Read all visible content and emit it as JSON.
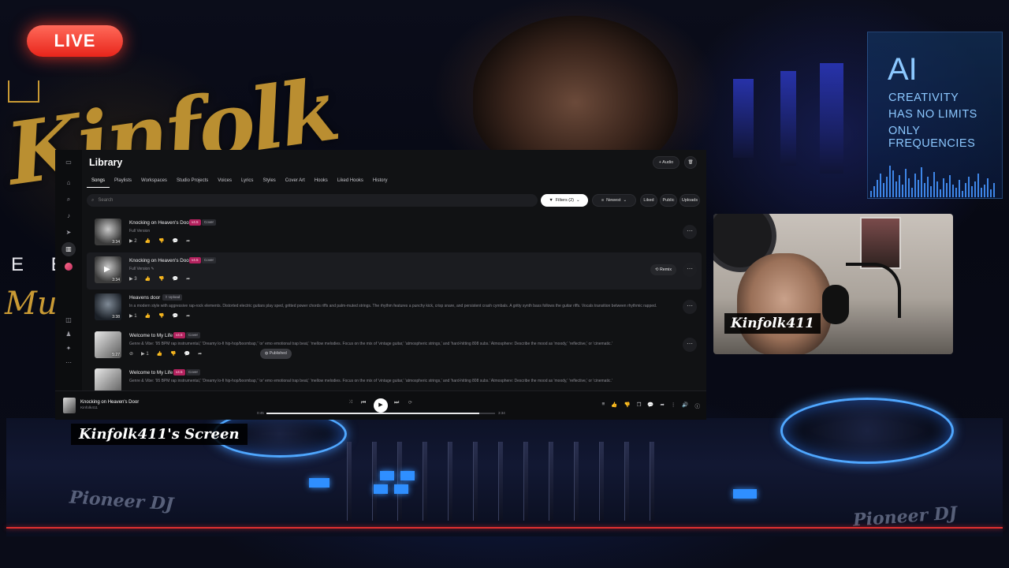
{
  "overlay": {
    "live_label": "LIVE",
    "brand_text": "Kinfolk",
    "brand_sub": "E E",
    "brand_much": "Much",
    "ai_panel": {
      "title": "AI",
      "lines": [
        "CREATIVITY",
        "HAS NO LIMITS",
        "ONLY FREQUENCIES"
      ]
    },
    "deck_brand_left": "Pioneer DJ",
    "deck_brand_right": "Pioneer DJ",
    "screen_caption": "Kinfolk411's Screen",
    "cam_caption": "Kinfolk411",
    "accent_live": "#e8251b",
    "accent_gold": "#c99a34",
    "accent_blue": "#4fa7ff"
  },
  "app": {
    "title": "Library",
    "header_buttons": {
      "audio": "+ Audio",
      "trash_icon": "trash-icon"
    },
    "rail_icons": [
      "window-icon",
      "home-icon",
      "search-icon",
      "create-icon",
      "explore-icon",
      "library-icon",
      "profile-icon",
      "notifications-icon",
      "invite-icon",
      "gift-icon",
      "more-icon"
    ],
    "tabs": [
      "Songs",
      "Playlists",
      "Workspaces",
      "Studio Projects",
      "Voices",
      "Lyrics",
      "Styles",
      "Cover Art",
      "Hooks",
      "Liked Hooks",
      "History"
    ],
    "active_tab": "Songs",
    "search_placeholder": "Search",
    "filters": {
      "filters_label": "Filters (2)",
      "sort_label": "Newest",
      "liked": "Liked",
      "public": "Public",
      "uploads": "Uploads"
    },
    "songs": [
      {
        "title": "Knocking on Heaven's Door",
        "badge_version": "v4.5",
        "badge_type": "Cover",
        "subtitle": "Full Version",
        "duration": "3:34",
        "plays": "2",
        "published": "",
        "remix": ""
      },
      {
        "title": "Knocking on Heaven's Door",
        "badge_version": "v4.5",
        "badge_type": "Cover",
        "subtitle": "Full Version",
        "duration": "3:34",
        "plays": "3",
        "published": "",
        "remix": "Remix"
      },
      {
        "title": "Heavens door",
        "badge_version": "",
        "badge_type": "Upload",
        "subtitle": "In a modern style with aggressive rap-rock elements. Distorted electric guitars play sped, gritted power chords riffs and palm-muted strings. The rhythm features a punchy kick, crisp snare, and persistent crash cymbals. A gritty synth bass follows the guitar riffs. Vocals transition between rhythmic rapped.",
        "duration": "3:38",
        "plays": "1",
        "published": "",
        "remix": ""
      },
      {
        "title": "Welcome to My Life",
        "badge_version": "v4.5",
        "badge_type": "Cover",
        "subtitle": "Genre & Vibe: '95 BPM rap instrumental,' 'Dreamy lo-fi hip-hop/boombap,' 'or' emo emotional trap beat,' 'mellow melodies. Focus on the mix of 'vintage guitar,' 'atmospheric strings,' and 'hard-hitting 808 subs.' Atmosphere: Describe the mood as 'moody,' 'reflective,' or 'cinematic.'",
        "duration": "5:27",
        "plays": "1",
        "published": "Published",
        "remix": ""
      },
      {
        "title": "Welcome to My Life",
        "badge_version": "v4.5",
        "badge_type": "Cover",
        "subtitle": "Genre & Vibe: '95 BPM rap instrumental,' 'Dreamy lo-fi hip-hop/boombap,' 'or' emo emotional trap beat,' 'mellow melodies. Focus on the mix of 'vintage guitar,' 'atmospheric strings,' and 'hard-hitting 808 subs.' Atmosphere: Describe the mood as 'moody,' 'reflective,' or 'cinematic.'",
        "duration": "",
        "plays": "",
        "published": "",
        "remix": ""
      }
    ],
    "player": {
      "title": "Knocking on Heaven's Door",
      "artist": "Kinfolk411",
      "elapsed": "0:45",
      "total": "3:34",
      "progress": 0.93
    }
  }
}
